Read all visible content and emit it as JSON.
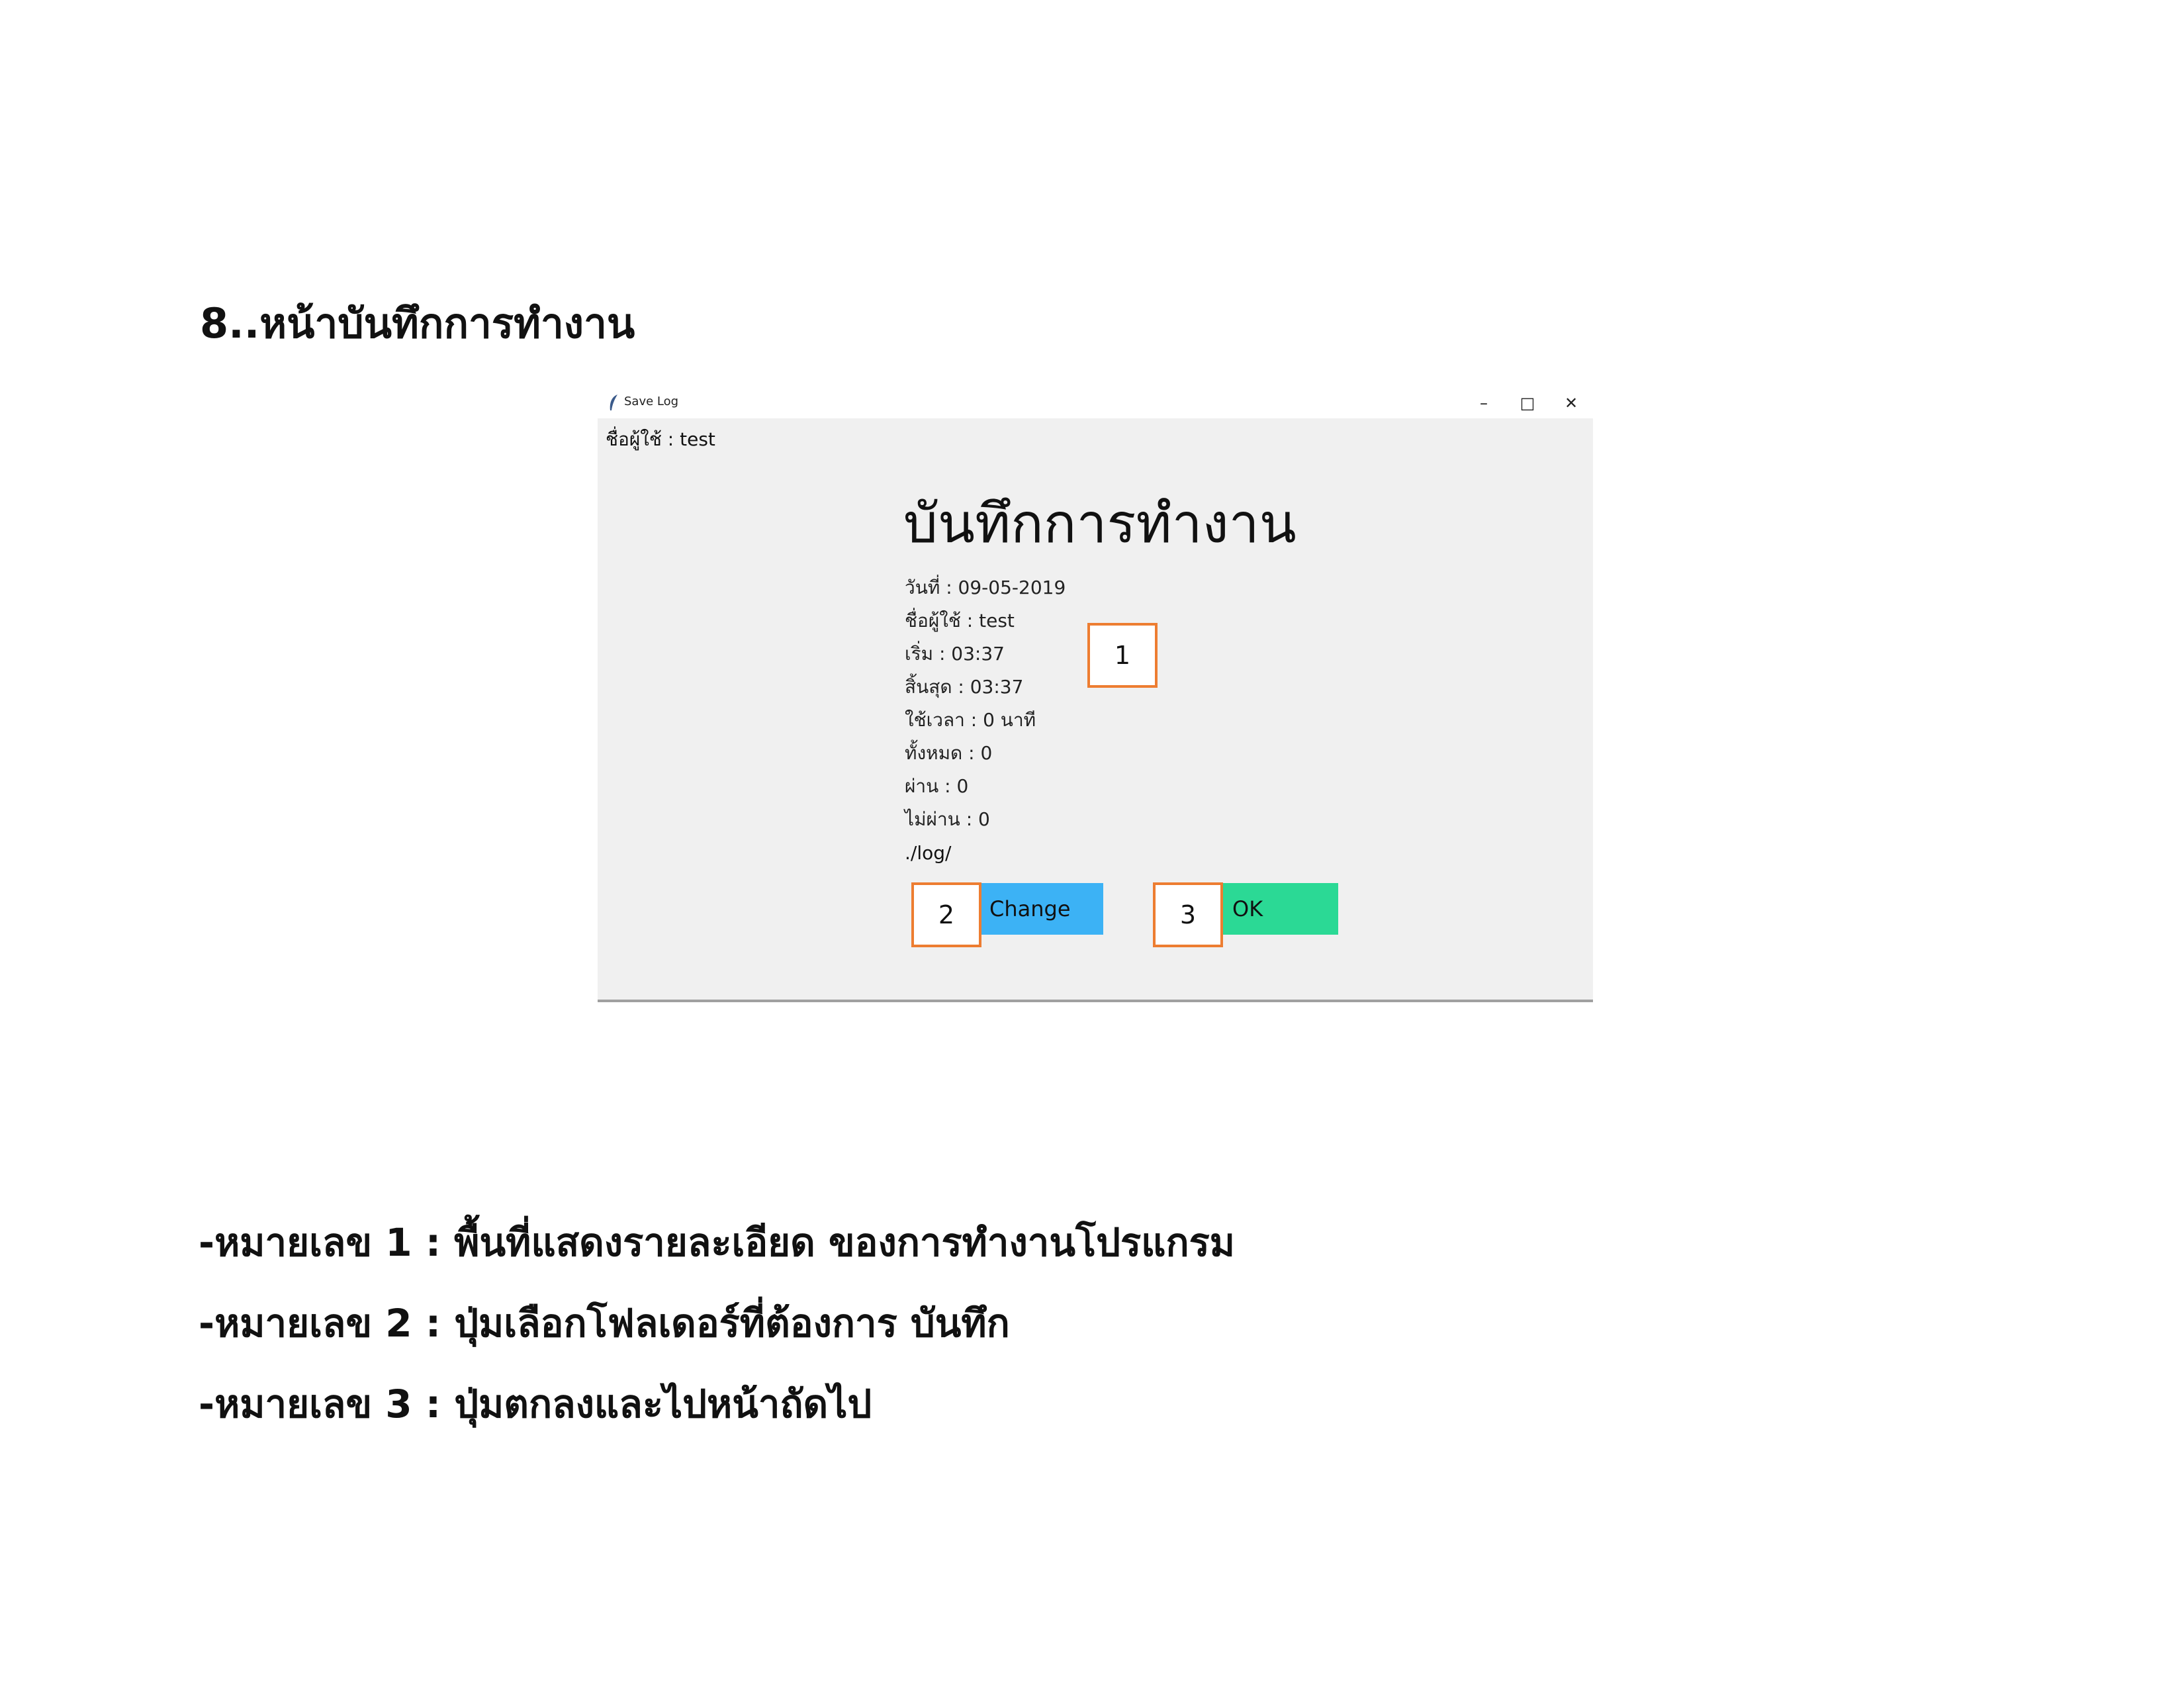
{
  "document": {
    "heading": "8..หน้าบันทึกการทำงาน",
    "legend": [
      "-หมายเลข 1 : พื้นที่แสดงรายละเอียด ของการทำงานโปรแกรม",
      "-หมายเลข 2 : ปุ่มเลือกโฟลเดอร์ที่ต้องการ บันทึก",
      "-หมายเลข 3 : ปุ่มตกลงและไปหน้าถัดไป"
    ]
  },
  "window": {
    "title": "Save Log",
    "icon": "feather-icon",
    "controls": {
      "minimize": "–",
      "maximize": "□",
      "close": "✕"
    }
  },
  "screen": {
    "user_label": "ชื่อผู้ใช้ : test",
    "title": "บันทึกการทำงาน",
    "details": [
      "วันที่ : 09-05-2019",
      "ชื่อผู้ใช้ : test",
      "เริ่ม : 03:37",
      "สิ้นสุด : 03:37",
      "ใช้เวลา : 0 นาที",
      "ทั้งหมด : 0",
      "ผ่าน : 0",
      "ไม่ผ่าน : 0"
    ],
    "path": "./log/",
    "change_button": "Change",
    "ok_button": "OK"
  },
  "markers": [
    "1",
    "2",
    "3"
  ],
  "colors": {
    "change_button": "#3cb2f5",
    "ok_button": "#2bd995",
    "marker_border": "#ed7d31",
    "window_bg": "#f0f0f0"
  }
}
